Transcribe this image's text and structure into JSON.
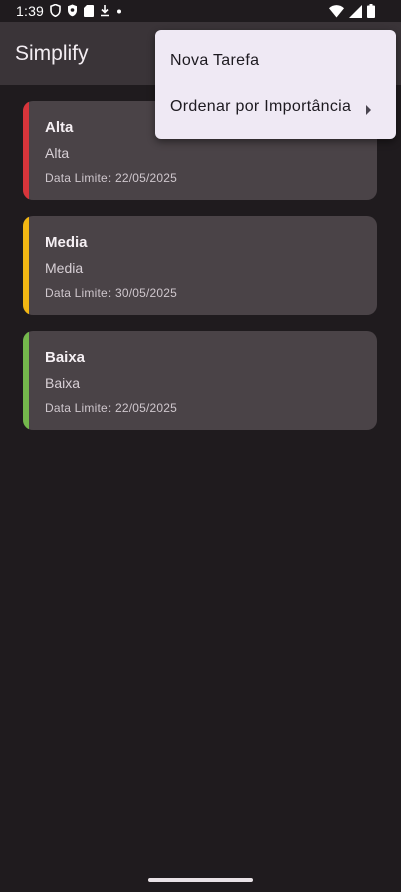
{
  "status_bar": {
    "time": "1:39"
  },
  "app_bar": {
    "title": "Simplify"
  },
  "menu": {
    "items": [
      {
        "label": "Nova Tarefa"
      },
      {
        "label": "Ordenar por Importância"
      }
    ]
  },
  "tasks": [
    {
      "title": "Alta",
      "description": "Alta",
      "deadline": "Data Limite: 22/05/2025",
      "color": "#d7353b"
    },
    {
      "title": "Media",
      "description": "Media",
      "deadline": "Data Limite: 30/05/2025",
      "color": "#f2b713"
    },
    {
      "title": "Baixa",
      "description": "Baixa",
      "deadline": "Data Limite: 22/05/2025",
      "color": "#74b84c"
    }
  ],
  "colors": {
    "background": "#1f1b1e",
    "app_bar": "#3a3438",
    "card": "#4a4347",
    "menu": "#efe9f4"
  },
  "icons": {
    "status_left": [
      "shield-icon",
      "shield-filled-icon",
      "sd-card-icon",
      "download-icon",
      "dot-icon"
    ],
    "status_right": [
      "wifi-icon",
      "signal-icon",
      "battery-icon"
    ],
    "submenu": "caret-right-icon"
  }
}
